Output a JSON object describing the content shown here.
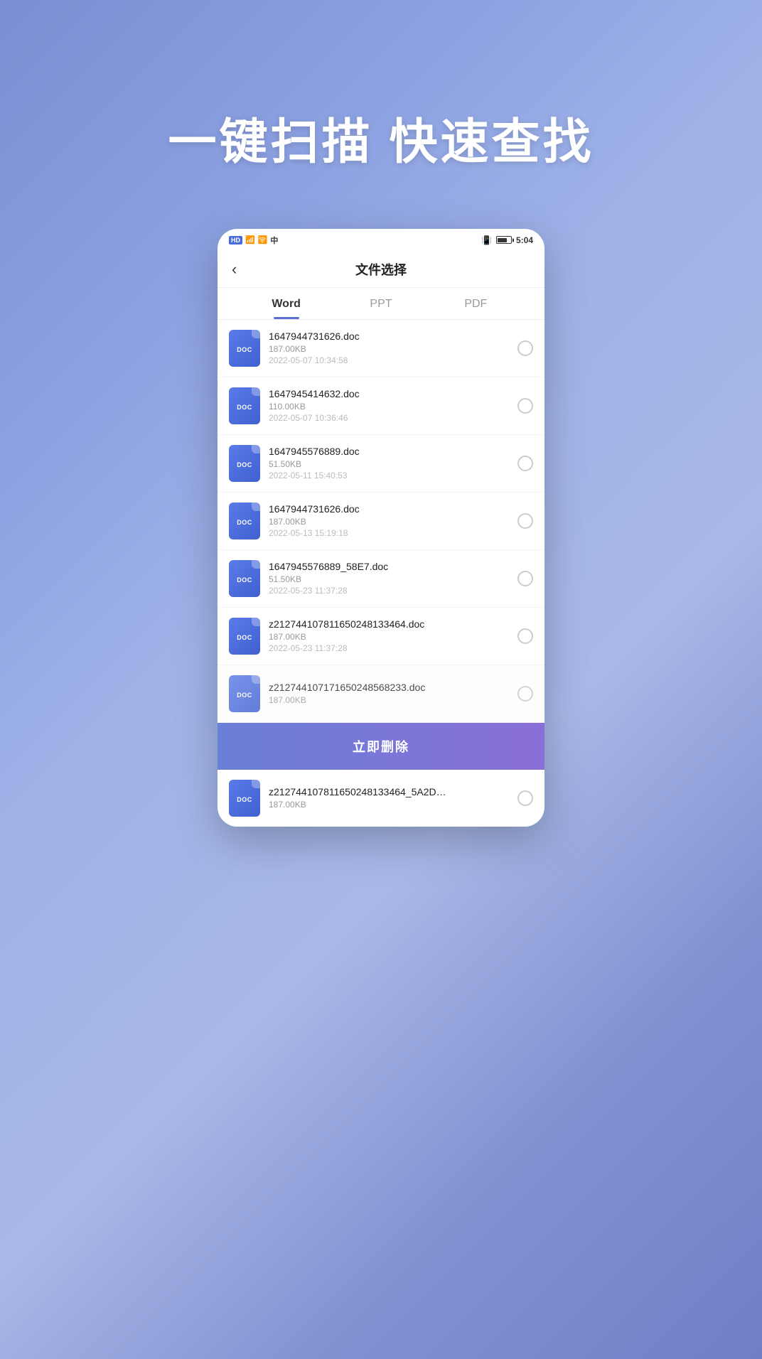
{
  "hero": {
    "tagline": "一键扫描 快速查找"
  },
  "statusBar": {
    "left": "HD  .all  ✦  中",
    "time": "5:04"
  },
  "header": {
    "title": "文件选择",
    "backLabel": "‹"
  },
  "tabs": [
    {
      "id": "word",
      "label": "Word",
      "active": true
    },
    {
      "id": "ppt",
      "label": "PPT",
      "active": false
    },
    {
      "id": "pdf",
      "label": "PDF",
      "active": false
    }
  ],
  "files": [
    {
      "name": "1647944731626.doc",
      "size": "187.00KB",
      "date": "2022-05-07  10:34:58",
      "icon": "DOC"
    },
    {
      "name": "1647945414632.doc",
      "size": "110.00KB",
      "date": "2022-05-07  10:36:46",
      "icon": "DOC"
    },
    {
      "name": "1647945576889.doc",
      "size": "51.50KB",
      "date": "2022-05-11  15:40:53",
      "icon": "DOC"
    },
    {
      "name": "1647944731626.doc",
      "size": "187.00KB",
      "date": "2022-05-13  15:19:18",
      "icon": "DOC"
    },
    {
      "name": "1647945576889_58E7.doc",
      "size": "51.50KB",
      "date": "2022-05-23  11:37:28",
      "icon": "DOC"
    },
    {
      "name": "z21274410781165024813346​4.doc",
      "size": "187.00KB",
      "date": "2022-05-23  11:37:28",
      "icon": "DOC"
    },
    {
      "name": "z212744107171650248568233.doc",
      "size": "187.00KB",
      "date": "",
      "icon": "DOC",
      "partial": true
    }
  ],
  "lastItem": {
    "name": "z2127441078116502481​33464_5A2D…",
    "size": "187.00KB",
    "icon": "DOC"
  },
  "deleteButton": {
    "label": "立即删除"
  }
}
